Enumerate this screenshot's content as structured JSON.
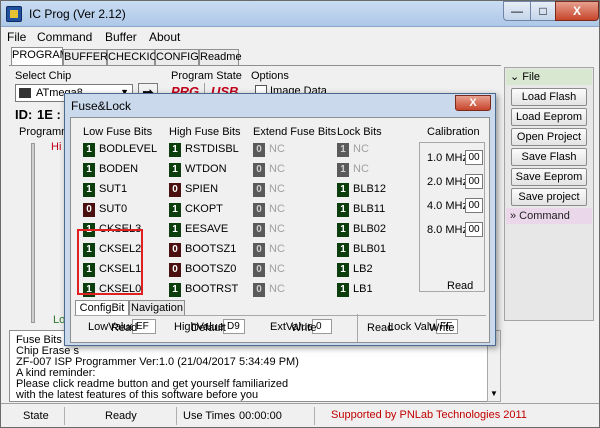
{
  "window": {
    "title": "IC Prog (Ver 2.12)",
    "minimize": "—",
    "maximize": "□",
    "close": "X"
  },
  "menu": [
    "File",
    "Command",
    "Buffer",
    "About"
  ],
  "tabs": [
    "PROGRAM",
    "BUFFER",
    "CHECKIO",
    "CONFIG",
    "Readme"
  ],
  "select_chip": {
    "label": "Select Chip",
    "value": "ATmega8",
    "goto": "➡"
  },
  "program_state": {
    "label": "Program State",
    "prg": "PRG",
    "usb": "USB"
  },
  "options": {
    "label": "Options",
    "image_data": "Image Data"
  },
  "id": {
    "label": "ID:",
    "value": "1E :"
  },
  "programming": {
    "label": "Programmi",
    "hi": "Hi",
    "lo": "Lo"
  },
  "right_panel": {
    "file_header": "File",
    "buttons": [
      "Load Flash",
      "Load Eeprom",
      "Open Project",
      "Save Flash",
      "Save Eeprom",
      "Save project"
    ],
    "command_header": "» Command"
  },
  "log": [
    "Fuse Bits su",
    "Chip Erase s",
    "ZF-007 ISP Programmer Ver:1.0 (21/04/2017 5:34:49 PM)",
    "A kind reminder:",
    "Please click readme button and get yourself familiarized",
    "with the latest features of this software before you"
  ],
  "status": {
    "state_label": "State",
    "state_value": "Ready",
    "use_times_label": "Use Times",
    "use_times_value": "00:00:00",
    "supported": "Supported by PNLab Technologies 2011"
  },
  "dialog": {
    "title": "Fuse&Lock",
    "close": "X",
    "headers": {
      "low": "Low Fuse Bits",
      "high": "High Fuse Bits",
      "ext": "Extend Fuse Bits",
      "lock": "Lock Bits",
      "cal": "Calibration"
    },
    "low_fuse": [
      {
        "bit": "1",
        "name": "BODLEVEL"
      },
      {
        "bit": "1",
        "name": "BODEN"
      },
      {
        "bit": "1",
        "name": "SUT1"
      },
      {
        "bit": "0",
        "name": "SUT0"
      },
      {
        "bit": "1",
        "name": "CKSEL3"
      },
      {
        "bit": "1",
        "name": "CKSEL2"
      },
      {
        "bit": "1",
        "name": "CKSEL1"
      },
      {
        "bit": "1",
        "name": "CKSEL0"
      }
    ],
    "high_fuse": [
      {
        "bit": "1",
        "name": "RSTDISBL"
      },
      {
        "bit": "1",
        "name": "WTDON"
      },
      {
        "bit": "0",
        "name": "SPIEN"
      },
      {
        "bit": "1",
        "name": "CKOPT"
      },
      {
        "bit": "1",
        "name": "EESAVE"
      },
      {
        "bit": "0",
        "name": "BOOTSZ1"
      },
      {
        "bit": "0",
        "name": "BOOTSZ0"
      },
      {
        "bit": "1",
        "name": "BOOTRST"
      }
    ],
    "ext_fuse": [
      {
        "bit": "0",
        "name": "NC"
      },
      {
        "bit": "0",
        "name": "NC"
      },
      {
        "bit": "0",
        "name": "NC"
      },
      {
        "bit": "0",
        "name": "NC"
      },
      {
        "bit": "0",
        "name": "NC"
      },
      {
        "bit": "0",
        "name": "NC"
      },
      {
        "bit": "0",
        "name": "NC"
      },
      {
        "bit": "0",
        "name": "NC"
      }
    ],
    "lock_bits": [
      {
        "bit": "1",
        "name": "NC"
      },
      {
        "bit": "1",
        "name": "NC"
      },
      {
        "bit": "1",
        "name": "BLB12"
      },
      {
        "bit": "1",
        "name": "BLB11"
      },
      {
        "bit": "1",
        "name": "BLB02"
      },
      {
        "bit": "1",
        "name": "BLB01"
      },
      {
        "bit": "1",
        "name": "LB2"
      },
      {
        "bit": "1",
        "name": "LB1"
      }
    ],
    "calibration": [
      {
        "freq": "1.0 MHz",
        "value": "00"
      },
      {
        "freq": "2.0 MHz",
        "value": "00"
      },
      {
        "freq": "4.0 MHz",
        "value": "00"
      },
      {
        "freq": "8.0 MHz",
        "value": "00"
      }
    ],
    "cal_read": "Read",
    "bottom_tabs": [
      "ConfigBit",
      "Navigation"
    ],
    "low_value_label": "LowValue",
    "low_value": "EF",
    "high_value_label": "HighValue",
    "high_value": "D9",
    "ext_value_label": "ExtValue",
    "ext_value": "0",
    "lock_value_label": "Lock Value",
    "lock_value": "FF",
    "actions": {
      "read": "Read",
      "default": "Default",
      "write": "Write",
      "lock_read": "Read",
      "lock_write": "Write"
    }
  }
}
